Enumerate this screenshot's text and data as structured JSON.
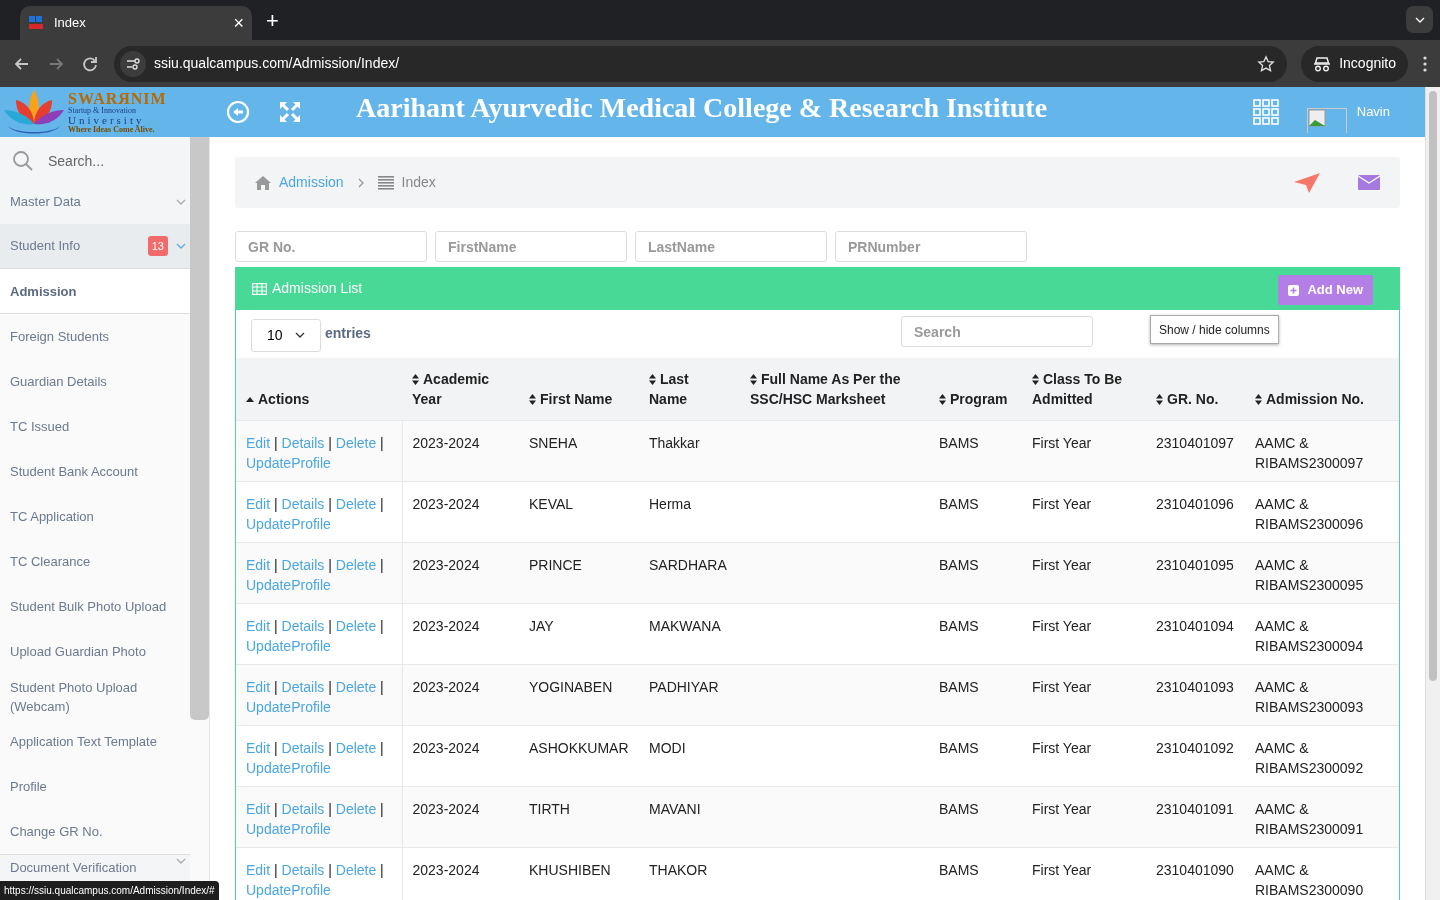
{
  "browser": {
    "tab": {
      "title": "Index",
      "close": "×",
      "new_tab": "+"
    },
    "url": "ssiu.qualcampus.com/Admission/Index/",
    "incognito": "Incognito",
    "status_url": "https://ssiu.qualcampus.com/Admission/Index/#"
  },
  "header": {
    "logo": {
      "name": "SWARЯNIM",
      "line_1": "Startup & Innovation",
      "line_2": "University",
      "tagline": "Where Ideas Come Alive."
    },
    "title": "Aarihant Ayurvedic Medical College & Research Institute",
    "user": "Navin"
  },
  "sidebar": {
    "search_placeholder": "Search...",
    "items": [
      {
        "label": "Master Data",
        "kind": "group",
        "expanded": false
      },
      {
        "label": "Student Info",
        "kind": "group",
        "expanded": true,
        "badge": "13",
        "children": [
          {
            "label": "Admission",
            "selected": true
          },
          {
            "label": "Foreign Students",
            "selected": false
          },
          {
            "label": "Guardian Details",
            "selected": false
          },
          {
            "label": "TC Issued",
            "selected": false
          },
          {
            "label": "Student Bank Account",
            "selected": false
          },
          {
            "label": "TC Application",
            "selected": false
          },
          {
            "label": "TC Clearance",
            "selected": false
          },
          {
            "label": "Student Bulk Photo Upload",
            "selected": false
          },
          {
            "label": "Upload Guardian Photo",
            "selected": false
          },
          {
            "label": "Student Photo Upload (Webcam)",
            "selected": false
          },
          {
            "label": "Application Text Template",
            "selected": false
          },
          {
            "label": "Profile",
            "selected": false
          },
          {
            "label": "Change GR No.",
            "selected": false
          }
        ]
      },
      {
        "label": "Document Verification",
        "kind": "group",
        "expanded": false
      }
    ]
  },
  "breadcrumb": [
    "Admission",
    "Index"
  ],
  "filters": [
    {
      "placeholder": "GR No."
    },
    {
      "placeholder": "FirstName"
    },
    {
      "placeholder": "LastName"
    },
    {
      "placeholder": "PRNumber"
    }
  ],
  "panel": {
    "title": "Admission List",
    "add_button": "Add New",
    "page_size": "10",
    "entries_label": "entries",
    "search_placeholder": "Search",
    "columns_button": "Show / hide columns"
  },
  "table": {
    "actions_column": "Actions",
    "columns": [
      "Academic Year",
      "First Name",
      "Last Name",
      "Full Name As Per the SSC/HSC Marksheet",
      "Program",
      "Class To Be Admitted",
      "GR. No.",
      "Admission No."
    ],
    "rows": [
      {
        "actions": [
          "Edit",
          "Details",
          "Delete",
          "UpdateProfile"
        ],
        "separator": "|",
        "cells": [
          "2023-2024",
          "SNEHA",
          "Thakkar",
          "",
          "BAMS",
          "First Year",
          "2310401097",
          "AAMC & RIBAMS2300097"
        ]
      },
      {
        "actions": [
          "Edit",
          "Details",
          "Delete",
          "UpdateProfile"
        ],
        "separator": "|",
        "cells": [
          "2023-2024",
          "KEVAL",
          "Herma",
          "",
          "BAMS",
          "First Year",
          "2310401096",
          "AAMC & RIBAMS2300096"
        ]
      },
      {
        "actions": [
          "Edit",
          "Details",
          "Delete",
          "UpdateProfile"
        ],
        "separator": "|",
        "cells": [
          "2023-2024",
          "PRINCE",
          "SARDHARA",
          "",
          "BAMS",
          "First Year",
          "2310401095",
          "AAMC & RIBAMS2300095"
        ]
      },
      {
        "actions": [
          "Edit",
          "Details",
          "Delete",
          "UpdateProfile"
        ],
        "separator": "|",
        "cells": [
          "2023-2024",
          "JAY",
          "MAKWANA",
          "",
          "BAMS",
          "First Year",
          "2310401094",
          "AAMC & RIBAMS2300094"
        ]
      },
      {
        "actions": [
          "Edit",
          "Details",
          "Delete",
          "UpdateProfile"
        ],
        "separator": "|",
        "cells": [
          "2023-2024",
          "YOGINABEN",
          "PADHIYAR",
          "",
          "BAMS",
          "First Year",
          "2310401093",
          "AAMC & RIBAMS2300093"
        ]
      },
      {
        "actions": [
          "Edit",
          "Details",
          "Delete",
          "UpdateProfile"
        ],
        "separator": "|",
        "cells": [
          "2023-2024",
          "ASHOKKUMAR",
          "MODI",
          "",
          "BAMS",
          "First Year",
          "2310401092",
          "AAMC & RIBAMS2300092"
        ]
      },
      {
        "actions": [
          "Edit",
          "Details",
          "Delete",
          "UpdateProfile"
        ],
        "separator": "|",
        "cells": [
          "2023-2024",
          "TIRTH",
          "MAVANI",
          "",
          "BAMS",
          "First Year",
          "2310401091",
          "AAMC & RIBAMS2300091"
        ]
      },
      {
        "actions": [
          "Edit",
          "Details",
          "Delete",
          "UpdateProfile"
        ],
        "separator": "|",
        "cells": [
          "2023-2024",
          "KHUSHIBEN",
          "THAKOR",
          "",
          "BAMS",
          "First Year",
          "2310401090",
          "AAMC & RIBAMS2300090"
        ]
      }
    ]
  }
}
